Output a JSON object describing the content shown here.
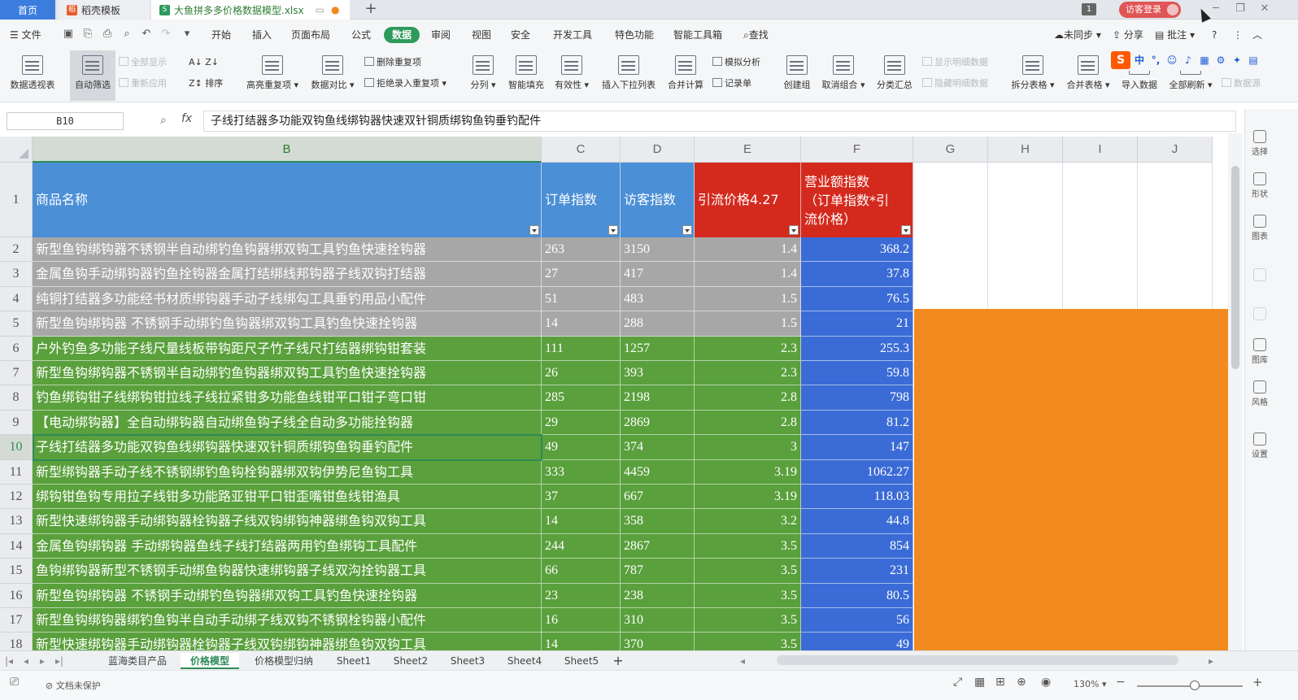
{
  "tabs": {
    "home": "首页",
    "template": "稻壳模板",
    "file": "大鱼拼多多价格数据模型.xlsx"
  },
  "titlebar": {
    "badge": "1",
    "login": "访客登录"
  },
  "menu": {
    "file": "文件",
    "items": [
      "开始",
      "插入",
      "页面布局",
      "公式",
      "数据",
      "审阅",
      "视图",
      "安全",
      "开发工具",
      "特色功能",
      "智能工具箱"
    ],
    "search": "查找",
    "unsynced": "未同步",
    "share": "分享",
    "comment": "批注"
  },
  "ribbon": {
    "pivot": "数据透视表",
    "autofilter": "自动筛选",
    "show_all": "全部显示",
    "reapply": "重新应用",
    "sort": "排序",
    "highlight_dup": "高亮重复项",
    "data_compare": "数据对比",
    "remove_dup": "删除重复项",
    "reject_dup": "拒绝录入重复项",
    "split": "分列",
    "smart_fill": "智能填充",
    "validity": "有效性",
    "dropdown": "插入下拉列表",
    "consolidate": "合并计算",
    "simulate": "模拟分析",
    "record": "记录单",
    "group": "创建组",
    "ungroup": "取消组合",
    "subtotal": "分类汇总",
    "show_detail": "显示明细数据",
    "hide_detail": "隐藏明细数据",
    "split_table": "拆分表格",
    "merge_table": "合并表格",
    "import": "导入数据",
    "refresh_all": "全部刷新",
    "data_src": "数据源"
  },
  "formula": {
    "cell_ref": "B10",
    "fx": "fx",
    "value": "子线打结器多功能双钩鱼线绑钩器快速双针铜质绑钩鱼钩垂钓配件"
  },
  "grid": {
    "columns": [
      "B",
      "C",
      "D",
      "E",
      "F",
      "G",
      "H",
      "I",
      "J"
    ],
    "headers": {
      "B": "商品名称",
      "C": "订单指数",
      "D": "访客指数",
      "E": "引流价格4.27",
      "F_line1": "营业额指数",
      "F_line2": "（订单指数*引",
      "F_line3": "流价格）"
    },
    "rows": [
      {
        "n": "2",
        "name": "新型鱼钩绑钩器不锈钢半自动绑钓鱼钩器绑双钩工具钓鱼快速拴钩器",
        "orders": "263",
        "visitors": "3150",
        "price": "1.4",
        "revenue": "368.2"
      },
      {
        "n": "3",
        "name": "金属鱼钩手动绑钩器钓鱼拴钩器金属打结绑线邦钩器子线双钩打结器",
        "orders": "27",
        "visitors": "417",
        "price": "1.4",
        "revenue": "37.8"
      },
      {
        "n": "4",
        "name": "纯铜打结器多功能经书材质绑钩器手动子线绑勾工具垂钓用品小配件",
        "orders": "51",
        "visitors": "483",
        "price": "1.5",
        "revenue": "76.5"
      },
      {
        "n": "5",
        "name": "新型鱼钩绑钩器 不锈钢手动绑钓鱼钩器绑双钩工具钓鱼快速拴钩器",
        "orders": "14",
        "visitors": "288",
        "price": "1.5",
        "revenue": "21"
      },
      {
        "n": "6",
        "name": "户外钓鱼多功能子线尺量线板带钩距尺子竹子线尺打结器绑钩钳套装",
        "orders": "111",
        "visitors": "1257",
        "price": "2.3",
        "revenue": "255.3"
      },
      {
        "n": "7",
        "name": "新型鱼钩绑钩器不锈钢半自动绑钓鱼钩器绑双钩工具钓鱼快速拴钩器",
        "orders": "26",
        "visitors": "393",
        "price": "2.3",
        "revenue": "59.8"
      },
      {
        "n": "8",
        "name": "钓鱼绑钩钳子线绑钩钳拉线子线拉紧钳多功能鱼线钳平口钳子弯口钳",
        "orders": "285",
        "visitors": "2198",
        "price": "2.8",
        "revenue": "798"
      },
      {
        "n": "9",
        "name": "【电动绑钩器】全自动绑钩器自动绑鱼钩子线全自动多功能拴钩器",
        "orders": "29",
        "visitors": "2869",
        "price": "2.8",
        "revenue": "81.2"
      },
      {
        "n": "10",
        "name": "子线打结器多功能双钩鱼线绑钩器快速双针铜质绑钩鱼钩垂钓配件",
        "orders": "49",
        "visitors": "374",
        "price": "3",
        "revenue": "147"
      },
      {
        "n": "11",
        "name": "新型绑钩器手动子线不锈钢绑钓鱼钩栓钩器绑双钩伊势尼鱼钩工具",
        "orders": "333",
        "visitors": "4459",
        "price": "3.19",
        "revenue": "1062.27"
      },
      {
        "n": "12",
        "name": "绑钩钳鱼钩专用拉子线钳多功能路亚钳平口钳歪嘴钳鱼线钳渔具",
        "orders": "37",
        "visitors": "667",
        "price": "3.19",
        "revenue": "118.03"
      },
      {
        "n": "13",
        "name": "新型快速绑钩器手动绑钩器栓钩器子线双钩绑钩神器绑鱼钩双钩工具",
        "orders": "14",
        "visitors": "358",
        "price": "3.2",
        "revenue": "44.8"
      },
      {
        "n": "14",
        "name": "金属鱼钩绑钩器 手动绑钩器鱼线子线打结器两用钓鱼绑钩工具配件",
        "orders": "244",
        "visitors": "2867",
        "price": "3.5",
        "revenue": "854"
      },
      {
        "n": "15",
        "name": "鱼钩绑钩器新型不锈钢手动绑鱼钩器快速绑钩器子线双沟拴钩器工具",
        "orders": "66",
        "visitors": "787",
        "price": "3.5",
        "revenue": "231"
      },
      {
        "n": "16",
        "name": "新型鱼钩绑钩器 不锈钢手动绑钓鱼钩器绑双钩工具钓鱼快速拴钩器",
        "orders": "23",
        "visitors": "238",
        "price": "3.5",
        "revenue": "80.5"
      },
      {
        "n": "17",
        "name": "新型鱼钩绑钩器绑钓鱼钩半自动手动绑子线双钩不锈钢栓钩器小配件",
        "orders": "16",
        "visitors": "310",
        "price": "3.5",
        "revenue": "56"
      },
      {
        "n": "18",
        "name": "新型快速绑钩器手动绑钩器栓钩器子线双钩绑钩神器绑鱼钩双钩工具",
        "orders": "14",
        "visitors": "370",
        "price": "3.5",
        "revenue": "49"
      }
    ]
  },
  "sidepanel": [
    "选择",
    "形状",
    "图表",
    "图库",
    "风格",
    "设置"
  ],
  "sheets": [
    "蓝海类目产品",
    "价格模型",
    "价格模型归纳",
    "Sheet1",
    "Sheet2",
    "Sheet3",
    "Sheet4",
    "Sheet5"
  ],
  "status": {
    "protect": "文档未保护",
    "zoom": "130%"
  },
  "colors": {
    "blue": "#4b8fd6",
    "red": "#d42a1e",
    "green": "#5aa03c",
    "gray": "#a7a7a7",
    "revenue_blue": "#3a6bd6",
    "orange": "#f28a20",
    "accent": "#2d9a5a"
  }
}
